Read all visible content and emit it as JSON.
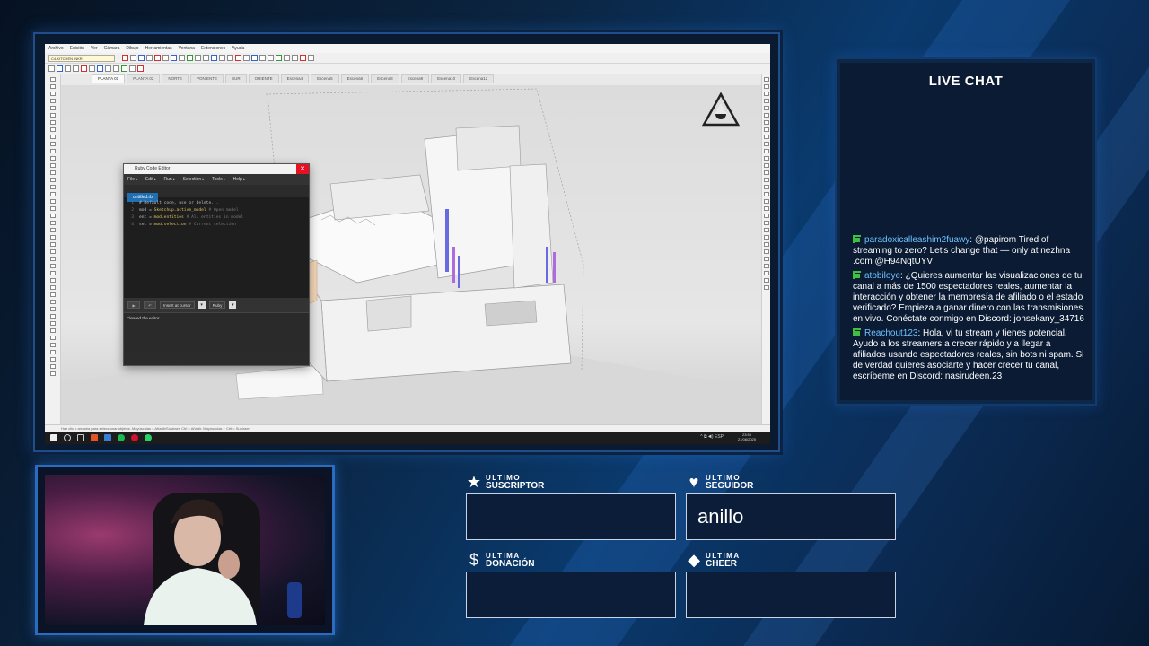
{
  "sketchup": {
    "menu": [
      "Archivo",
      "Edición",
      "Ver",
      "Cámara",
      "Dibujo",
      "Herramientas",
      "Ventana",
      "Extensiones",
      "Ayuda"
    ],
    "layer": "C4-KITCHEN INKR",
    "scene_tabs": [
      "PLANTA 01",
      "PLANTA 02",
      "NORTE",
      "PONIENTE",
      "SUR",
      "ORIENTE",
      "Escena4",
      "Escena5",
      "Escena6",
      "Escena8",
      "Escena9",
      "Escena10",
      "Escena12"
    ],
    "status": "Haz clic o arrastra para seleccionar objetos. Mayúsculas = Añadir/Sustraer. Ctrl = Añadir. Mayúsculas + Ctrl = Sustraer."
  },
  "ruby_editor": {
    "title": "Ruby Code Editor",
    "menu": [
      "File ▸",
      "Edit ▸",
      "Run ▸",
      "Selection ▸",
      "Tools ▸",
      "Help ▸"
    ],
    "tab": "untitled.rb",
    "code": [
      {
        "n": "1",
        "pre": "",
        "kw": "",
        "post": "# Default code, use or delete..."
      },
      {
        "n": "2",
        "pre": "mod = ",
        "kw": "Sketchup.active_model",
        "post": " # Open model"
      },
      {
        "n": "3",
        "pre": "ent = ",
        "kw": "mod.entities",
        "post": " # All entities in model"
      },
      {
        "n": "4",
        "pre": "sel = ",
        "kw": "mod.selection",
        "post": " # Current selection"
      }
    ],
    "insert_mode": "Insert at cursor",
    "language": "Ruby",
    "output": "Cleared the editor"
  },
  "taskbar": {
    "tray": "^ ⧉ ◀) ESP",
    "time": "23:55",
    "date": "21/08/2025"
  },
  "chat": {
    "title": "LIVE CHAT",
    "messages": [
      {
        "user": "paradoxicalleashim2fuawy",
        "text": " @papirom Tired of streaming to zero? Let's change that — only at nezhna .com @H94NqtUYV"
      },
      {
        "user": "atobiloye",
        "text": " ¿Quieres aumentar las visualizaciones de tu canal a más de 1500 espectadores reales, aumentar la interacción y obtener la membresía de afiliado o el estado verificado? Empieza a ganar dinero con las transmisiones en vivo. Conéctate conmigo en Discord: jonsekany_34716"
      },
      {
        "user": "Reachout123",
        "text": " Hola, vi tu stream y tienes potencial. Ayudo a los streamers a crecer rápido y a llegar a afiliados usando espectadores reales, sin bots ni spam. Si de verdad quieres asociarte y hacer crecer tu canal, escríbeme en Discord: nasirudeen.23"
      }
    ]
  },
  "alerts": {
    "subscriber": {
      "line1": "ULTIMO",
      "line2": "SUSCRIPTOR",
      "icon": "star-icon",
      "value": ""
    },
    "follower": {
      "line1": "ULTIMO",
      "line2": "SEGUIDOR",
      "icon": "heart-icon",
      "value": "anillo"
    },
    "donation": {
      "line1": "ULTIMA",
      "line2": "DONACIÓN",
      "icon": "dollar-icon",
      "value": ""
    },
    "cheer": {
      "line1": "ULTIMA",
      "line2": "CHEER",
      "icon": "diamond-icon",
      "value": ""
    }
  },
  "colors": {
    "accent": "#2a6cc0",
    "chat_user": "#6ec1ff",
    "chat_badge": "#3fbf3f",
    "close": "#e81123"
  }
}
